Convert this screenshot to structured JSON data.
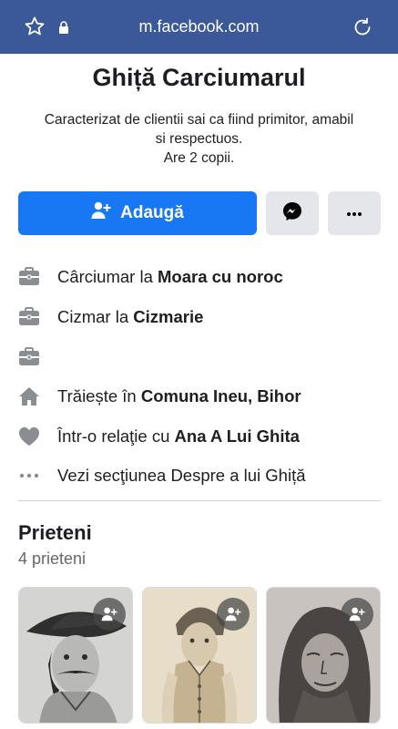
{
  "browser": {
    "url": "m.facebook.com"
  },
  "profile": {
    "name": "Ghiță Carciumarul",
    "bio_line1": "Caracterizat de clientii sai ca fiind primitor, amabil",
    "bio_line2": "si respectuos.",
    "bio_line3": "Are 2 copii."
  },
  "actions": {
    "add_label": "Adaugă"
  },
  "info": [
    {
      "prefix": "Cârciumar la ",
      "bold": "Moara cu noroc",
      "icon": "briefcase-icon"
    },
    {
      "prefix": "Cizmar la ",
      "bold": "Cizmarie",
      "icon": "briefcase-icon"
    },
    {
      "prefix": "",
      "bold": "",
      "icon": "briefcase-icon"
    },
    {
      "prefix": "Trăiește în ",
      "bold": "Comuna Ineu, Bihor",
      "icon": "home-icon"
    },
    {
      "prefix": "Într-o relaţie cu ",
      "bold": "Ana A Lui Ghita",
      "icon": "heart-icon"
    },
    {
      "prefix": "Vezi secţiunea Despre a lui Ghiță",
      "bold": "",
      "icon": "more-horizontal-icon"
    }
  ],
  "friends": {
    "title": "Prieteni",
    "count": "4 prieteni"
  },
  "colors": {
    "browser_bar": "#3b5998",
    "primary_button": "#1877f2",
    "secondary_button": "#e4e6eb",
    "icon_grey": "#8a8d91",
    "muted_text": "#65676b"
  }
}
